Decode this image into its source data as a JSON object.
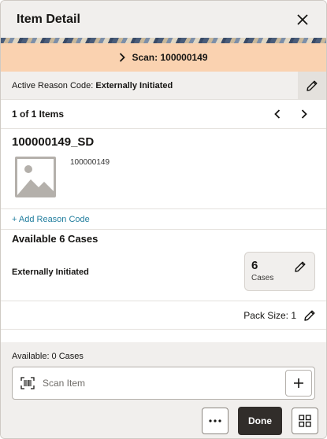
{
  "header": {
    "title": "Item Detail"
  },
  "scan_banner": {
    "label": "Scan: 100000149"
  },
  "reason": {
    "prefix": "Active Reason Code: ",
    "value": "Externally Initiated"
  },
  "items_nav": {
    "count": "1 of 1 Items"
  },
  "item": {
    "id": "100000149_SD",
    "description": "100000149"
  },
  "add_reason": {
    "label": "+ Add Reason Code"
  },
  "available": {
    "title": "Available 6 Cases",
    "reason": "Externally Initiated",
    "qty": "6",
    "unit": "Cases"
  },
  "pack": {
    "label": "Pack Size: 1"
  },
  "bottom": {
    "available_cases": "Available: 0 Cases",
    "scan_placeholder": "Scan Item"
  },
  "actions": {
    "done_label": "Done"
  },
  "colors": {
    "banner": "#fad2b0",
    "link": "#227e9e",
    "primary_button": "#312d2a"
  }
}
